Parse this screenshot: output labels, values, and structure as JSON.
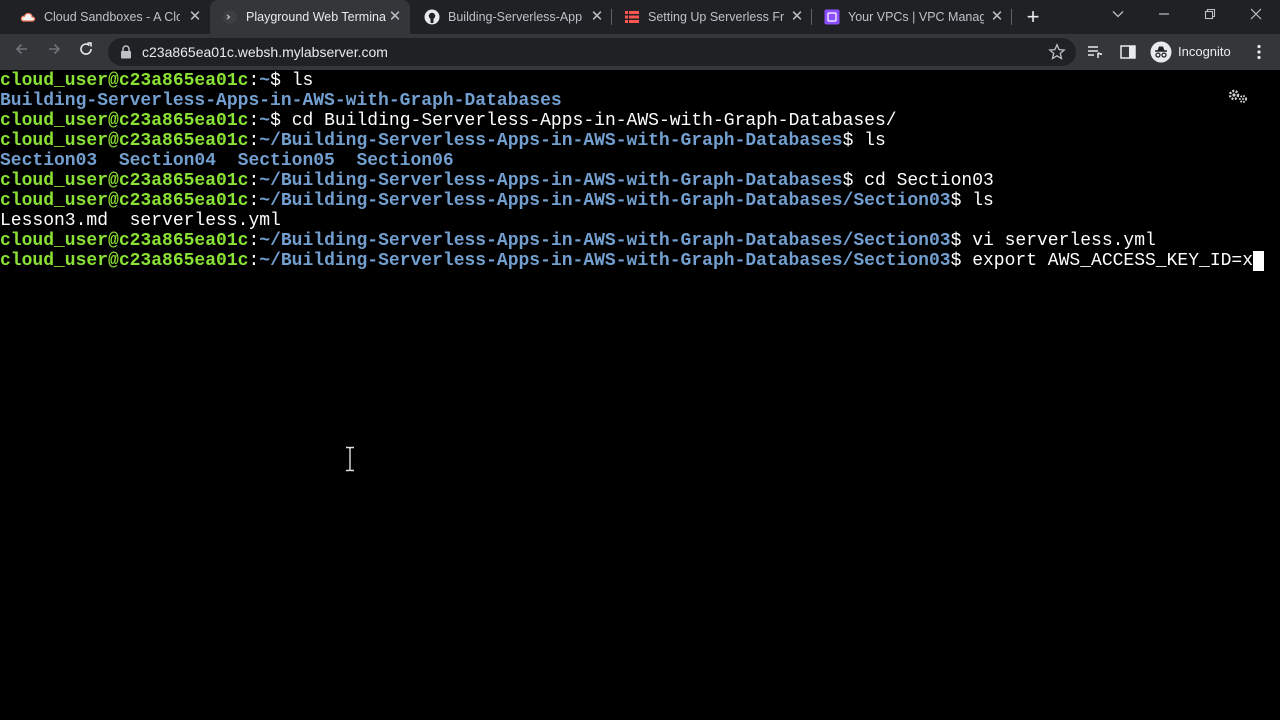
{
  "browser": {
    "tabs": [
      {
        "title": "Cloud Sandboxes - A Clou",
        "icon": "cloud-icon",
        "active": false
      },
      {
        "title": "Playground Web Terminal",
        "icon": "terminal-icon",
        "active": true
      },
      {
        "title": "Building-Serverless-Apps",
        "icon": "github-icon",
        "active": false
      },
      {
        "title": "Setting Up Serverless Fra",
        "icon": "serverless-icon",
        "active": false
      },
      {
        "title": "Your VPCs | VPC Manager",
        "icon": "vpc-icon",
        "active": false
      }
    ],
    "url": "c23a865ea01c.websh.mylabserver.com",
    "profile_label": "Incognito"
  },
  "terminal": {
    "prompt_user": "cloud_user@c23a865ea01c",
    "lines": [
      {
        "type": "prompt",
        "path": "~",
        "cmd": " ls"
      },
      {
        "type": "dir",
        "text": "Building-Serverless-Apps-in-AWS-with-Graph-Databases"
      },
      {
        "type": "prompt",
        "path": "~",
        "cmd": " cd Building-Serverless-Apps-in-AWS-with-Graph-Databases/"
      },
      {
        "type": "prompt",
        "path": "~/Building-Serverless-Apps-in-AWS-with-Graph-Databases",
        "cmd": " ls"
      },
      {
        "type": "dir",
        "text": "Section03  Section04  Section05  Section06"
      },
      {
        "type": "prompt",
        "path": "~/Building-Serverless-Apps-in-AWS-with-Graph-Databases",
        "cmd": " cd Section03"
      },
      {
        "type": "prompt",
        "path": "~/Building-Serverless-Apps-in-AWS-with-Graph-Databases/Section03",
        "cmd": " ls"
      },
      {
        "type": "plain",
        "text": "Lesson3.md  serverless.yml"
      },
      {
        "type": "prompt",
        "path": "~/Building-Serverless-Apps-in-AWS-with-Graph-Databases/Section03",
        "cmd": " vi serverless.yml"
      },
      {
        "type": "prompt",
        "path": "~/Building-Serverless-Apps-in-AWS-with-Graph-Databases/Section03",
        "cmd": " export AWS_ACCESS_KEY_ID=x",
        "cursor": true
      }
    ],
    "colors": {
      "user": "#8ae234",
      "path": "#729fcf",
      "text": "#ffffff",
      "background": "#000000"
    }
  }
}
